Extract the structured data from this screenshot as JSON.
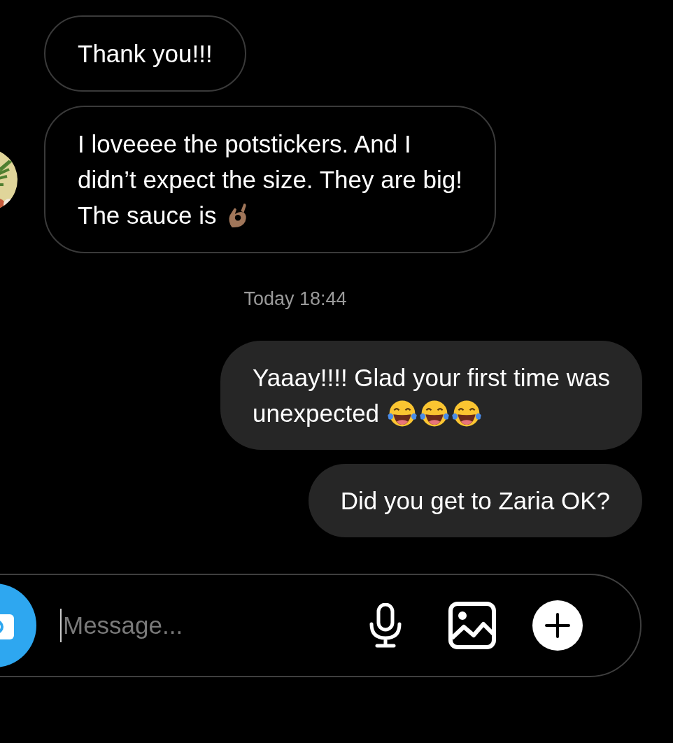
{
  "messages": [
    {
      "kind": "incoming",
      "lines": [
        "Thank you!!!"
      ],
      "show_avatar": false
    },
    {
      "kind": "incoming",
      "lines": [
        "I loveeee the potstickers. And I",
        "didn’t expect the size. They are big!",
        "The sauce is"
      ],
      "show_avatar": true,
      "emoji": [
        {
          "kind": "ok-hand"
        }
      ]
    },
    {
      "kind": "timestamp",
      "text": "Today 18:44"
    },
    {
      "kind": "outgoing",
      "lines": [
        "Yaaay!!!! Glad your first time was",
        "unexpected"
      ],
      "emoji": [
        {
          "kind": "laugh"
        },
        {
          "kind": "laugh"
        },
        {
          "kind": "laugh"
        }
      ]
    },
    {
      "kind": "outgoing",
      "lines": [
        "Did you get to Zaria OK?"
      ]
    }
  ],
  "composer": {
    "placeholder": "Message..."
  }
}
